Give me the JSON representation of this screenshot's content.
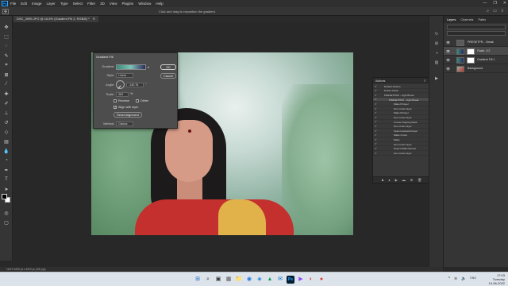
{
  "menubar": {
    "items": [
      "File",
      "Edit",
      "Image",
      "Layer",
      "Type",
      "Select",
      "Filter",
      "3D",
      "View",
      "Plugins",
      "Window",
      "Help"
    ],
    "window_controls": [
      "—",
      "❐",
      "✕"
    ]
  },
  "optbar": {
    "hint": "Click and drag to reposition the gradient."
  },
  "tab": {
    "title": "DSC_3995.JPG @ 16.5% (Gradient Fill 2, RGB/8) *",
    "close": "✕"
  },
  "dialog": {
    "title": "Gradient Fill",
    "gradient_label": "Gradient:",
    "style_label": "Style:",
    "style_value": "Linear",
    "angle_label": "Angle:",
    "angle_value": "-140.76",
    "angle_unit": "°",
    "scale_label": "Scale:",
    "scale_value": "363",
    "scale_unit": "%",
    "reverse_label": "Reverse",
    "dither_label": "Dither",
    "align_label": "Align with layer",
    "reset_label": "Reset Alignment",
    "method_label": "Method:",
    "method_value": "Classic",
    "ok_label": "OK",
    "cancel_label": "Cancel"
  },
  "actions_panel": {
    "title": "Actions",
    "rows": [
      {
        "check": "✓",
        "text": "Default Actions",
        "indent": 1
      },
      {
        "check": "✓",
        "text": "Poster Action",
        "indent": 1
      },
      {
        "check": "✓",
        "text": "PRESETPRO - Light Break",
        "indent": 1
      },
      {
        "check": "✓",
        "text": "PRESETPRO - Light Break",
        "indent": 2,
        "sel": true
      },
      {
        "check": "✓",
        "text": "Make fill layer",
        "indent": 3
      },
      {
        "check": "✓",
        "text": "Set current layer",
        "indent": 3
      },
      {
        "check": "✓",
        "text": "Make fill layer",
        "indent": 3
      },
      {
        "check": "✓",
        "text": "Set current layer",
        "indent": 3
      },
      {
        "check": "✓",
        "text": "Create Clipping Mask",
        "indent": 3
      },
      {
        "check": "✓",
        "text": "Set current layer",
        "indent": 3
      },
      {
        "check": "✓",
        "text": "Select backward layer",
        "indent": 3
      },
      {
        "check": "✓",
        "text": "Make Group",
        "indent": 3
      },
      {
        "check": "✓",
        "text": "Make",
        "indent": 3
      },
      {
        "check": "✓",
        "text": "Set current layer",
        "indent": 3
      },
      {
        "check": "✓",
        "text": "Select RGB channel",
        "indent": 3
      },
      {
        "check": "✓",
        "text": "Set current layer",
        "indent": 3
      }
    ],
    "footer": [
      "■",
      "●",
      "▶",
      "▬",
      "⊞",
      "🗑"
    ]
  },
  "layers_panel": {
    "tabs": [
      "Layers",
      "Channels",
      "Paths"
    ],
    "active_tab": "Layers",
    "layers": [
      {
        "name": "PRESETPR... Break",
        "sel": false,
        "type": "group"
      },
      {
        "name": "Gradi...ll 2",
        "sel": true,
        "type": "fill"
      },
      {
        "name": "Gradient Fill 1",
        "sel": false,
        "type": "fill"
      },
      {
        "name": "Background",
        "sel": false,
        "type": "photo"
      }
    ]
  },
  "status": {
    "text": "16.5%    6000 px x 4000 px (300 ppi)"
  },
  "taskbar": {
    "time": "17:03",
    "day": "Tuesday",
    "date": "14-06-2022",
    "lang": "ENG",
    "icons": [
      {
        "glyph": "⊞",
        "color": "#1f6fd1"
      },
      {
        "glyph": "⌕",
        "color": "#333"
      },
      {
        "glyph": "▣",
        "color": "#333"
      },
      {
        "glyph": "▦",
        "color": "#555"
      },
      {
        "glyph": "📁",
        "color": "#e6b422"
      },
      {
        "glyph": "◉",
        "color": "#1a73e8"
      },
      {
        "glyph": "◈",
        "color": "#0a7fd9"
      },
      {
        "glyph": "▲",
        "color": "#0f9d58"
      },
      {
        "glyph": "✉",
        "color": "#0072c6"
      },
      {
        "glyph": "Ps",
        "color": "#31a8ff"
      },
      {
        "glyph": "▶",
        "color": "#9147ff"
      },
      {
        "glyph": "◐",
        "color": "#ea4335"
      },
      {
        "glyph": "●",
        "color": "#e53935"
      }
    ]
  }
}
